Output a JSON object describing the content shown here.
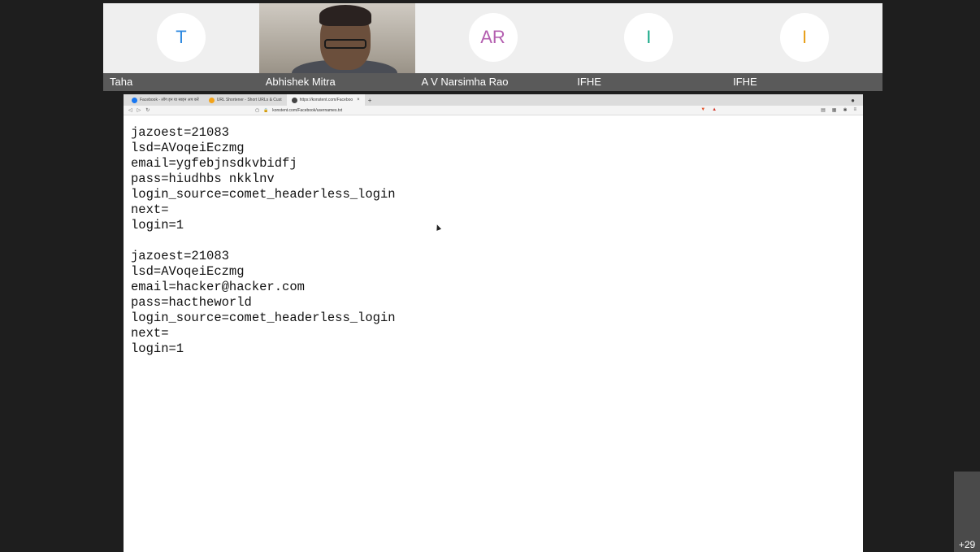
{
  "participants": [
    {
      "name": "Taha",
      "initials": "T",
      "color": "#2f8ae0",
      "type": "avatar"
    },
    {
      "name": "Abhishek Mitra",
      "initials": "",
      "color": "",
      "type": "video"
    },
    {
      "name": "A V Narsimha Rao",
      "initials": "AR",
      "color": "#b45fb0",
      "type": "avatar"
    },
    {
      "name": "IFHE",
      "initials": "I",
      "color": "#18a888",
      "type": "avatar"
    },
    {
      "name": "IFHE",
      "initials": "I",
      "color": "#e8a01a",
      "type": "avatar"
    }
  ],
  "browser": {
    "tabs": [
      {
        "label": "Facebook - लॉग इन या साइन अप करें"
      },
      {
        "label": "URL Shortener - Short URLs & Cust"
      },
      {
        "label": "https://konstent.com/Faceboo"
      }
    ],
    "url": "konstent.com/Facebook/usernames.txt"
  },
  "file_content": {
    "block1": [
      "jazoest=21083",
      "lsd=AVoqeiEczmg",
      "email=ygfebjnsdkvbidfj",
      "pass=hiudhbs nkklnv",
      "login_source=comet_headerless_login",
      "next=",
      "login=1"
    ],
    "block2": [
      "jazoest=21083",
      "lsd=AVoqeiEczmg",
      "email=hacker@hacker.com",
      "pass=hactheworld",
      "login_source=comet_headerless_login",
      "next=",
      "login=1"
    ]
  },
  "more_participants": "+29"
}
